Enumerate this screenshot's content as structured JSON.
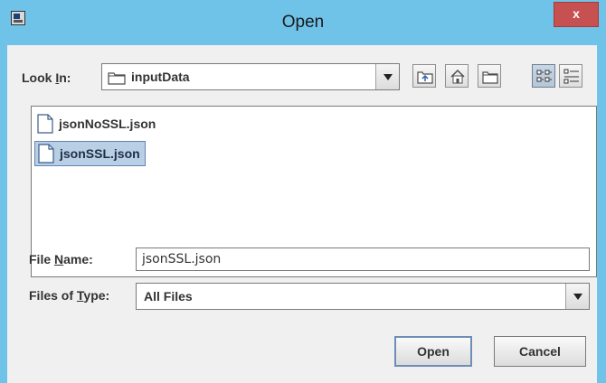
{
  "window": {
    "title": "Open",
    "close_label": "x"
  },
  "look_in": {
    "label_pre": "Look ",
    "label_key": "I",
    "label_post": "n:",
    "value": "inputData"
  },
  "toolbar": {
    "up": "up-one-level-icon",
    "home": "home-icon",
    "new_folder": "new-folder-icon",
    "list_view": "list-view-icon",
    "details_view": "details-view-icon"
  },
  "files": [
    {
      "name": "jsonNoSSL.json",
      "selected": false
    },
    {
      "name": "jsonSSL.json",
      "selected": true
    }
  ],
  "file_name": {
    "label_pre": "File ",
    "label_key": "N",
    "label_post": "ame:",
    "value": "jsonSSL.json"
  },
  "files_of_type": {
    "label_pre": "Files of ",
    "label_key": "T",
    "label_post": "ype:",
    "value": "All Files"
  },
  "buttons": {
    "open": "Open",
    "cancel": "Cancel"
  }
}
